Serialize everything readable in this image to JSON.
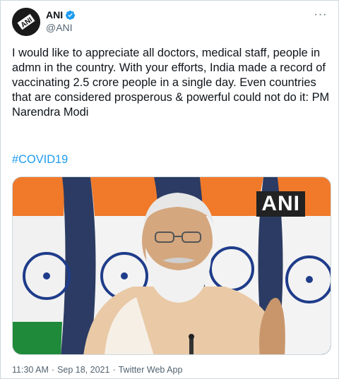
{
  "tweet": {
    "author": {
      "display_name": "ANI",
      "handle": "@ANI",
      "verified": true,
      "avatar_icon": "ani-logo-icon"
    },
    "more_icon": "more-options-icon",
    "more_label": "···",
    "text": "I would like to appreciate all doctors, medical staff, people in admn in the country. With your efforts, India made a record of vaccinating 2.5 crore people in a single day. Even countries that are considered prosperous & powerful could not do it: PM Narendra Modi",
    "hashtag": "#COVID19",
    "media": {
      "watermark": "ANI"
    },
    "meta": {
      "time": "11:30 AM",
      "separator": "·",
      "date": "Sep 18, 2021",
      "separator2": "·",
      "client": "Twitter Web App"
    }
  },
  "colors": {
    "link": "#1d9bf0",
    "secondary_text": "#536471",
    "border": "#cfd9de"
  }
}
